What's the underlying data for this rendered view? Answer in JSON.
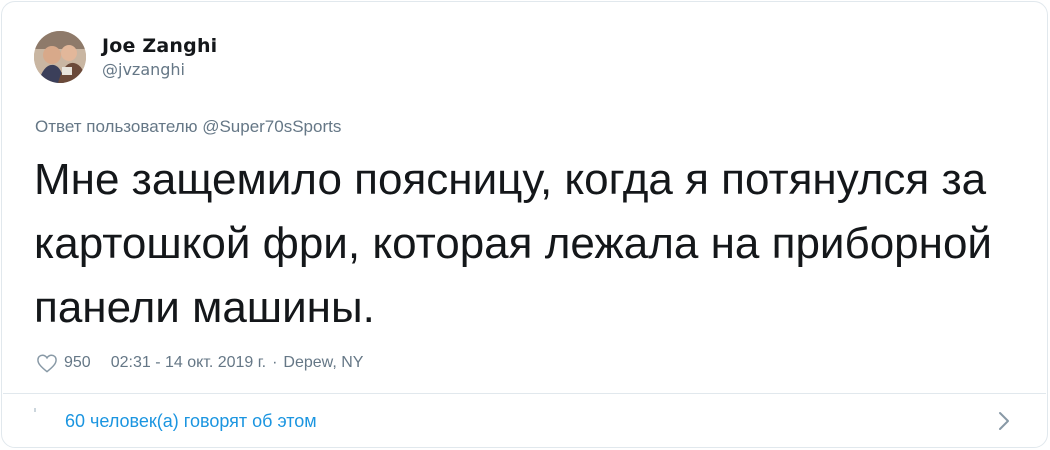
{
  "author": {
    "display_name": "Joe Zanghi",
    "handle": "@jvzanghi"
  },
  "reply": {
    "prefix": "Ответ пользователю",
    "mention": "@Super70sSports"
  },
  "tweet": {
    "text": "Мне защемило поясницу, когда я потянулся за картошкой фри, которая лежала на приборной панели машины."
  },
  "meta": {
    "likes": "950",
    "timestamp": "02:31 - 14 окт. 2019 г.",
    "separator": "·",
    "location": "Depew, NY"
  },
  "footer": {
    "people_talking": "60 человек(а) говорят об этом"
  },
  "icons": {
    "heart": "heart-icon",
    "chevron": "chevron-right-icon"
  },
  "colors": {
    "text": "#14171a",
    "secondary": "#657786",
    "link": "#1b95e0",
    "border": "#e1e8ed"
  }
}
